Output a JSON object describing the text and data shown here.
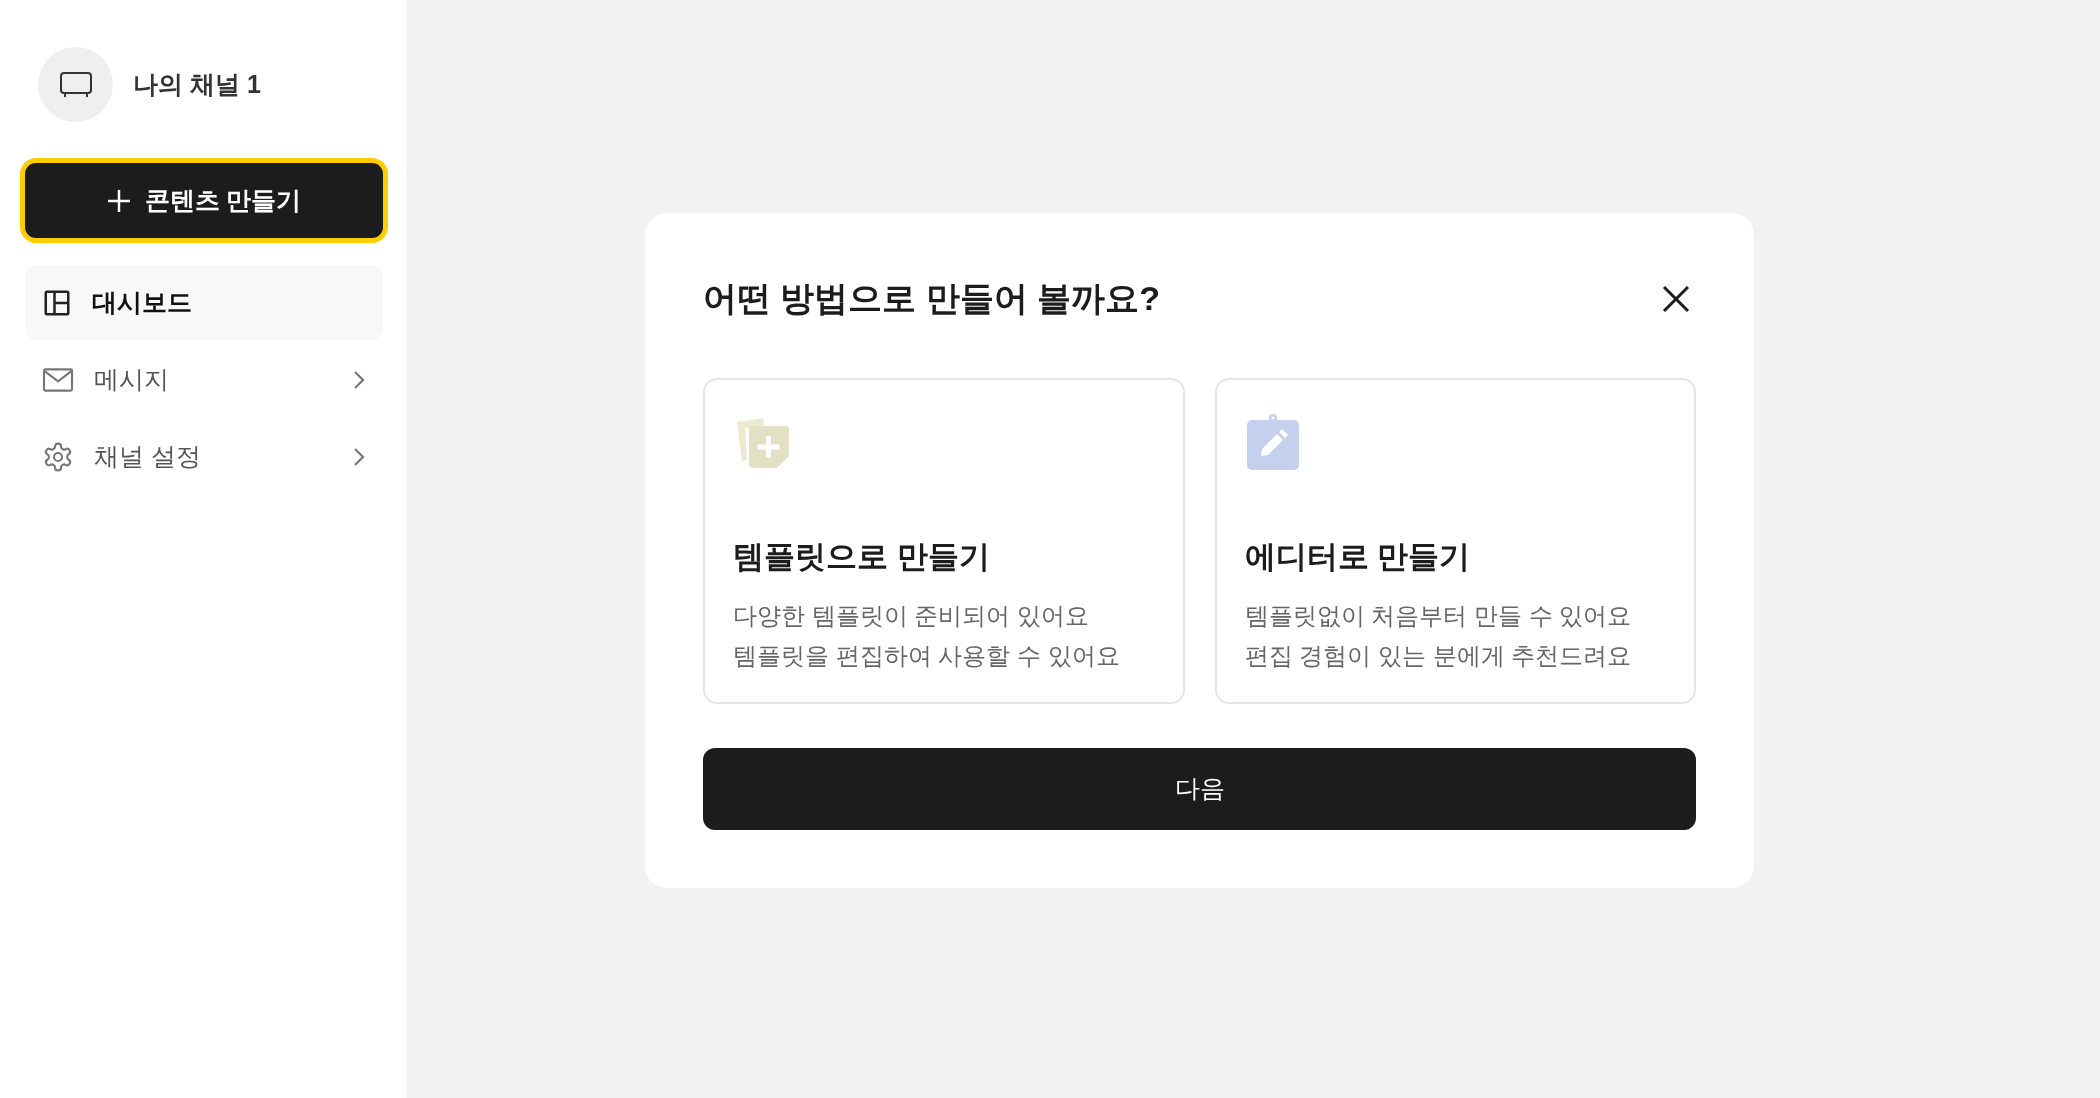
{
  "sidebar": {
    "channel_name": "나의 채널 1",
    "create_button": "콘텐츠 만들기",
    "items": [
      {
        "label": "대시보드",
        "kind": "dashboard",
        "selected": true,
        "has_arrow": false
      },
      {
        "label": "메시지",
        "kind": "message",
        "selected": false,
        "has_arrow": true
      },
      {
        "label": "채널 설정",
        "kind": "settings",
        "selected": false,
        "has_arrow": true
      }
    ]
  },
  "dialog": {
    "title": "어떤 방법으로 만들어 볼까요?",
    "options": [
      {
        "kind": "template",
        "title": "템플릿으로 만들기",
        "lines": [
          "다양한 템플릿이 준비되어 있어요",
          "템플릿을 편집하여 사용할 수 있어요"
        ],
        "selected": false
      },
      {
        "kind": "editor",
        "title": "에디터로 만들기",
        "lines": [
          "템플릿없이 처음부터 만들 수 있어요",
          "편집 경험이 있는 분에게 추천드려요"
        ],
        "selected": false
      }
    ],
    "next_button": "다음"
  }
}
